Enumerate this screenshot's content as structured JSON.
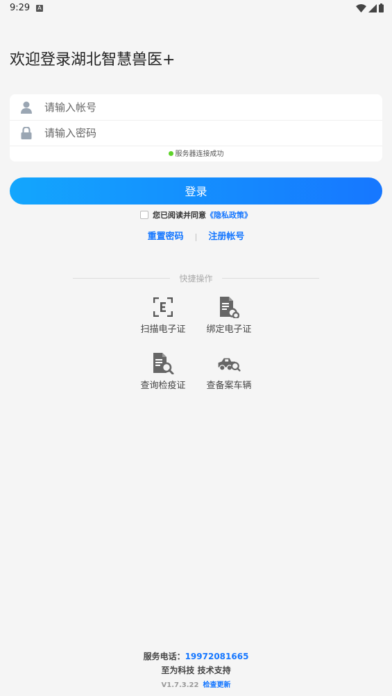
{
  "status_bar": {
    "time": "9:29",
    "notification_glyph": "A"
  },
  "welcome": "欢迎登录湖北智慧兽医+",
  "form": {
    "account_placeholder": "请输入帐号",
    "password_placeholder": "请输入密码",
    "server_status": "服务器连接成功"
  },
  "login_button": "登录",
  "agreement": {
    "text": "您已阅读并同意",
    "link": "《隐私政策》"
  },
  "links": {
    "reset": "重置密码",
    "separator": "|",
    "register": "注册帐号"
  },
  "quick": {
    "title": "快捷操作",
    "actions": [
      {
        "label": "扫描电子证",
        "icon": "scan-e-icon"
      },
      {
        "label": "绑定电子证",
        "icon": "document-link-icon"
      },
      {
        "label": "查询检疫证",
        "icon": "document-search-icon"
      },
      {
        "label": "查备案车辆",
        "icon": "vehicle-search-icon"
      }
    ]
  },
  "footer": {
    "phone_label": "服务电话：",
    "phone": "19972081665",
    "support": "至为科技 技术支持",
    "version": "V1.7.3.22",
    "update": "检查更新"
  },
  "colors": {
    "accent": "#1677ff",
    "gradient_start": "#13a6fd",
    "status_ok": "#5ed32a"
  }
}
